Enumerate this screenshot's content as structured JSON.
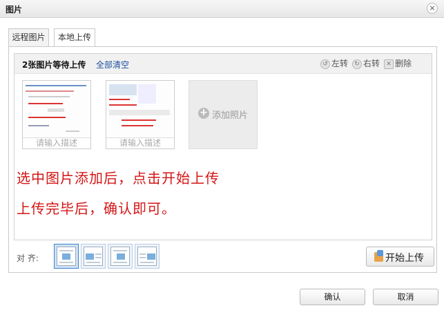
{
  "dialog": {
    "title": "图片",
    "close_glyph": "×"
  },
  "tabs": [
    {
      "label": "远程图片",
      "active": false
    },
    {
      "label": "本地上传",
      "active": true
    }
  ],
  "upload": {
    "count_text": "2张图片等待上传",
    "clear_all": "全部清空",
    "actions": {
      "rotate_left": "左转",
      "rotate_right": "右转",
      "delete": "删除"
    },
    "items": [
      {
        "desc_placeholder": "请输入描述"
      },
      {
        "desc_placeholder": "请输入描述"
      }
    ],
    "add_photo": "添加照片",
    "add_glyph": "+",
    "notes": [
      "选中图片添加后，点击开始上传",
      "上传完毕后，确认即可。"
    ],
    "start_upload": "开始上传"
  },
  "align": {
    "label": "对  齐:",
    "options": [
      "none",
      "left",
      "center",
      "right"
    ],
    "selected": "none"
  },
  "footer": {
    "confirm": "确认",
    "cancel": "取消"
  },
  "icons": {
    "close": "close-icon",
    "rotate_left": "rotate-left-icon",
    "rotate_right": "rotate-right-icon",
    "delete": "delete-icon",
    "add": "plus-icon",
    "upload": "upload-icon"
  },
  "colors": {
    "note_text": "#d41414",
    "link": "#1a4ea0",
    "selected_align": "#cfe2f6"
  }
}
